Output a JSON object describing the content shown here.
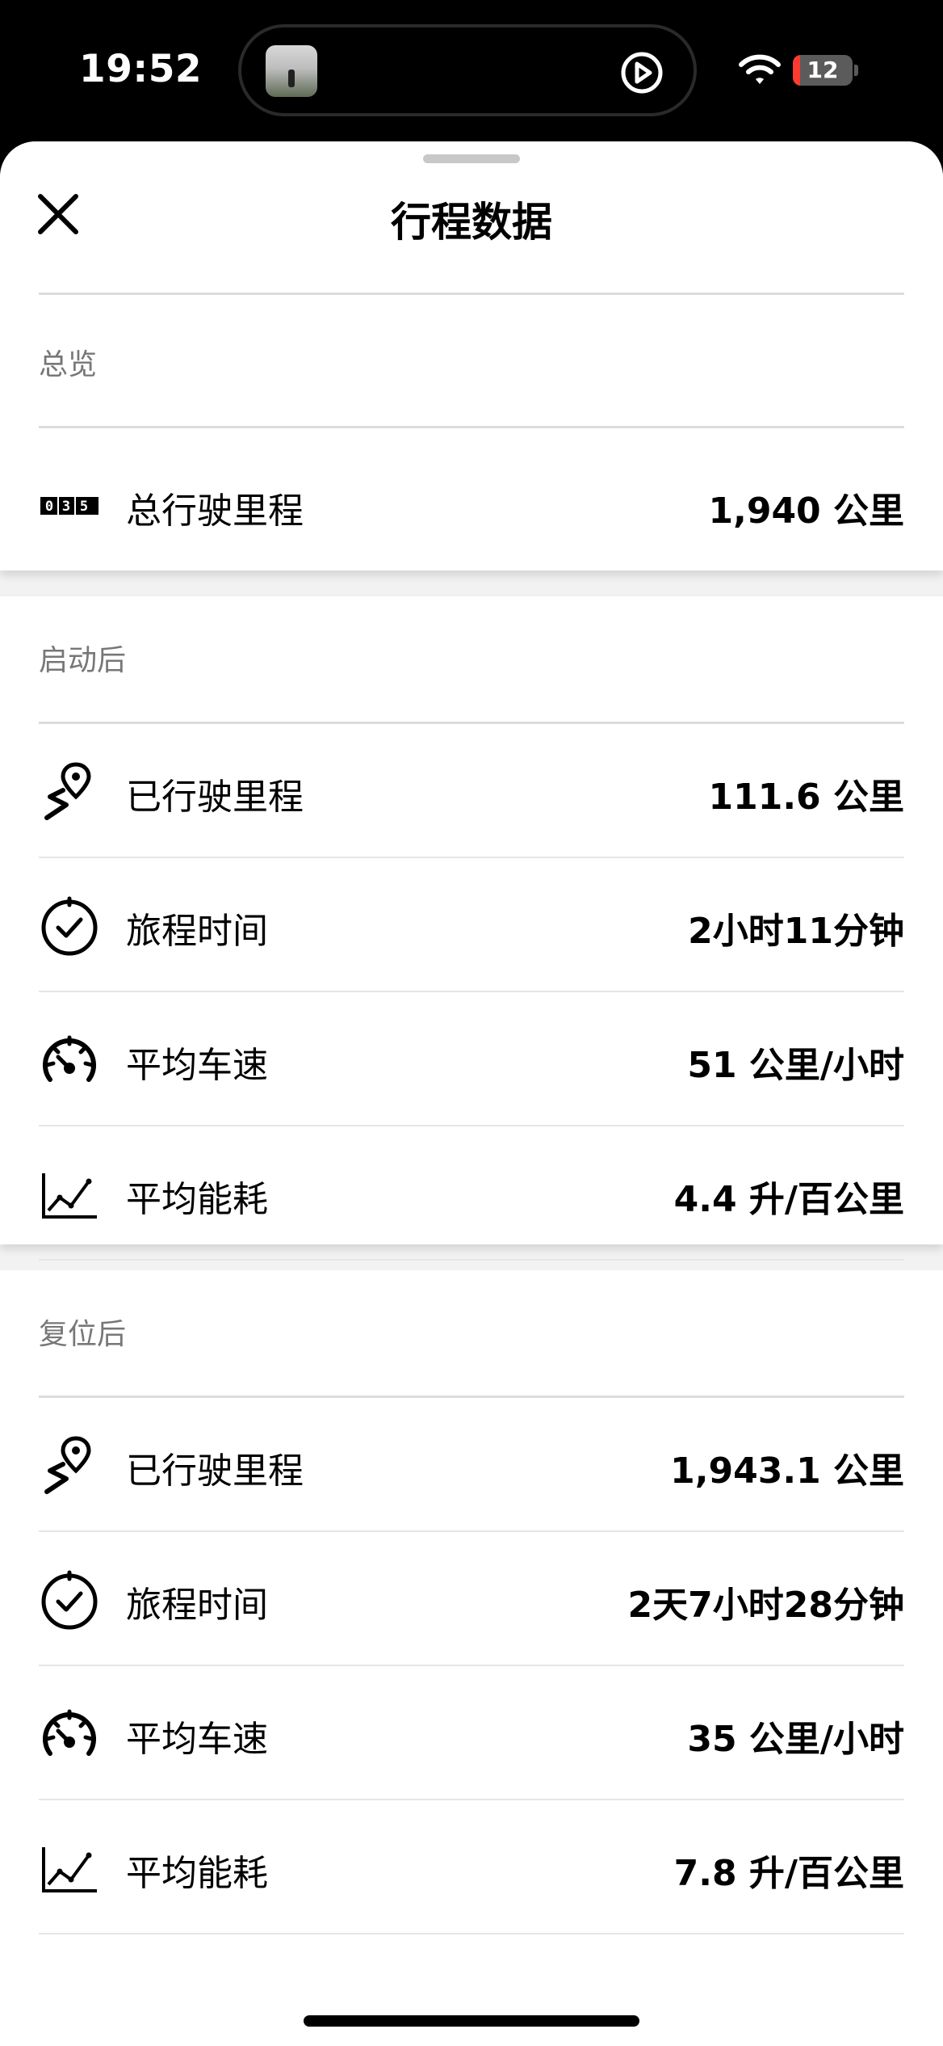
{
  "status": {
    "time": "19:52",
    "battery": "12",
    "battery_level": 0.12
  },
  "sheet": {
    "title": "行程数据"
  },
  "overview": {
    "label": "总览",
    "row": {
      "icon": "odometer-icon",
      "label": "总行驶里程",
      "value": "1,940 公里"
    }
  },
  "since_start": {
    "label": "启动后",
    "rows": [
      {
        "icon": "route-pin-icon",
        "label": "已行驶里程",
        "value": "111.6 公里"
      },
      {
        "icon": "clock-icon",
        "label": "旅程时间",
        "value": "2小时11分钟"
      },
      {
        "icon": "speedometer-icon",
        "label": "平均车速",
        "value": "51 公里/小时"
      },
      {
        "icon": "line-chart-icon",
        "label": "平均能耗",
        "value": "4.4 升/百公里"
      }
    ]
  },
  "since_reset": {
    "label": "复位后",
    "rows": [
      {
        "icon": "route-pin-icon",
        "label": "已行驶里程",
        "value": "1,943.1 公里"
      },
      {
        "icon": "clock-icon",
        "label": "旅程时间",
        "value": "2天7小时28分钟"
      },
      {
        "icon": "speedometer-icon",
        "label": "平均车速",
        "value": "35 公里/小时"
      },
      {
        "icon": "line-chart-icon",
        "label": "平均能耗",
        "value": "7.8 升/百公里"
      }
    ]
  },
  "colors": {
    "accent": "#000000",
    "battery_low": "#ff3b30",
    "background": "#f2f2f2"
  }
}
